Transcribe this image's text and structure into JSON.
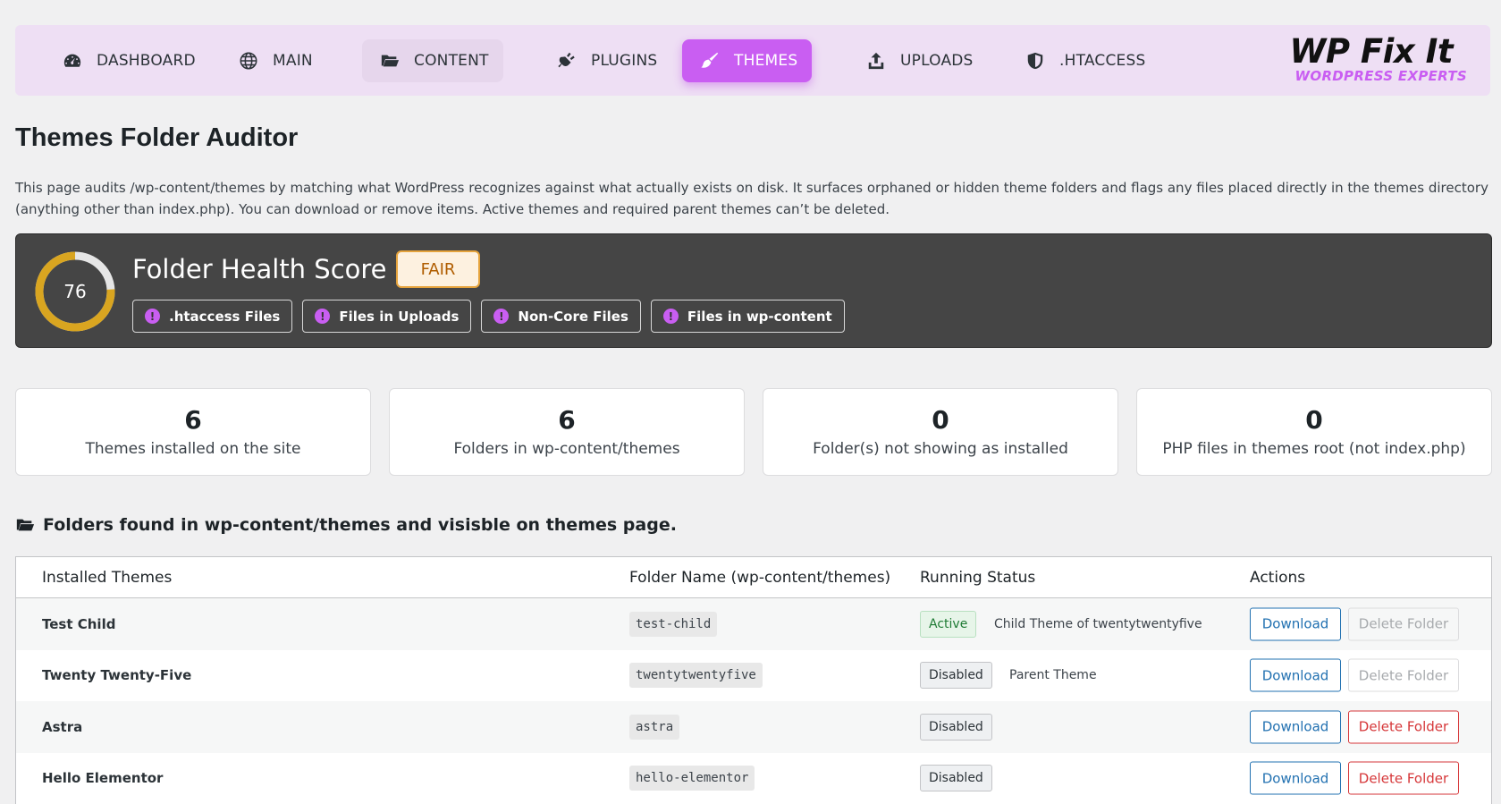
{
  "nav": {
    "items": [
      {
        "label": "DASHBOARD",
        "icon": "dashboard-icon"
      },
      {
        "label": "MAIN",
        "icon": "globe-icon"
      },
      {
        "label": "CONTENT",
        "icon": "folder-open-icon"
      },
      {
        "label": "PLUGINS",
        "icon": "plug-icon"
      },
      {
        "label": "THEMES",
        "icon": "paintbrush-icon",
        "active": true
      },
      {
        "label": "UPLOADS",
        "icon": "upload-icon"
      },
      {
        "label": ".HTACCESS",
        "icon": "shield-icon"
      }
    ],
    "logo_main": "WP Fix It",
    "logo_sub": "WORDPRESS EXPERTS"
  },
  "page": {
    "title": "Themes Folder Auditor",
    "description": "This page audits /wp-content/themes by matching what WordPress recognizes against what actually exists on disk. It surfaces orphaned or hidden theme folders and flags any files placed directly in the themes directory (anything other than index.php). You can download or remove items. Active themes and required parent themes can’t be deleted."
  },
  "health": {
    "score": "76",
    "score_fraction": 0.76,
    "title": "Folder Health Score =",
    "rating": "FAIR",
    "chips": [
      {
        "label": ".htaccess Files",
        "icon": "exclamation-icon"
      },
      {
        "label": "Files in Uploads",
        "icon": "exclamation-icon"
      },
      {
        "label": "Non-Core Files",
        "icon": "exclamation-icon"
      },
      {
        "label": "Files in wp-content",
        "icon": "exclamation-icon"
      }
    ],
    "colors": {
      "gauge_fill": "#d9a520",
      "gauge_track": "#e6e6e6",
      "accent": "#c95ef2"
    }
  },
  "stats": [
    {
      "value": "6",
      "label": "Themes installed on the site"
    },
    {
      "value": "6",
      "label": "Folders in wp-content/themes"
    },
    {
      "value": "0",
      "label": "Folder(s) not showing as installed"
    },
    {
      "value": "0",
      "label": "PHP files in themes root (not index.php)"
    }
  ],
  "section": {
    "title": "Folders found in wp-content/themes and visisble on themes page.",
    "icon": "folder-icon"
  },
  "table": {
    "headers": [
      "Installed Themes",
      "Folder Name (wp-content/themes)",
      "Running Status",
      "Actions"
    ],
    "download_label": "Download",
    "delete_label": "Delete Folder",
    "rows": [
      {
        "name": "Test Child",
        "folder": "test-child",
        "status": "Active",
        "note": "Child Theme of twentytwentyfive",
        "delete_enabled": false
      },
      {
        "name": "Twenty Twenty-Five",
        "folder": "twentytwentyfive",
        "status": "Disabled",
        "note": "Parent Theme",
        "delete_enabled": false
      },
      {
        "name": "Astra",
        "folder": "astra",
        "status": "Disabled",
        "note": "",
        "delete_enabled": true
      },
      {
        "name": "Hello Elementor",
        "folder": "hello-elementor",
        "status": "Disabled",
        "note": "",
        "delete_enabled": true
      }
    ]
  }
}
